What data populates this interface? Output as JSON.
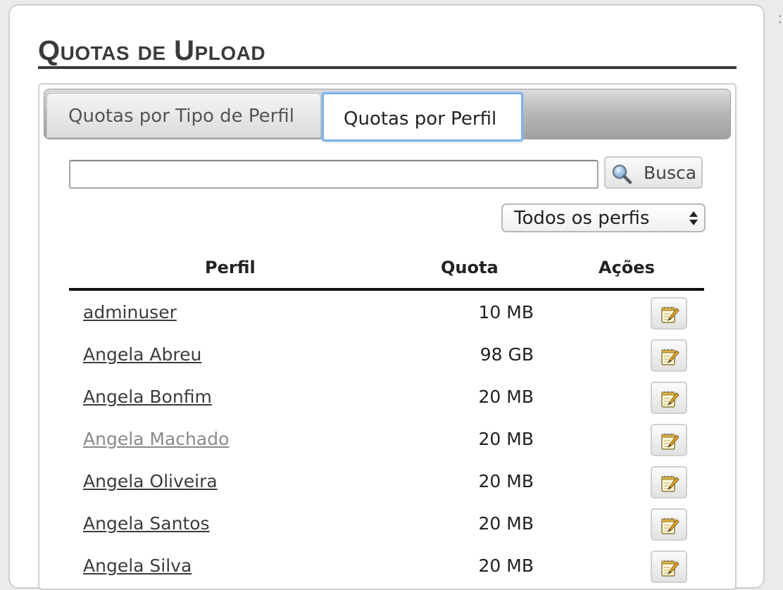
{
  "page": {
    "title": "Quotas de Upload"
  },
  "tabs": [
    {
      "label": "Quotas por Tipo de Perfil",
      "active": false
    },
    {
      "label": "Quotas por Perfil",
      "active": true
    }
  ],
  "search": {
    "value": "",
    "placeholder": "",
    "button_label": "Busca",
    "button_icon": "magnifier-icon"
  },
  "filter": {
    "selected": "Todos os perfis",
    "icon": "updown-arrows-icon"
  },
  "table": {
    "columns": [
      "Perfil",
      "Quota",
      "Ações"
    ],
    "action_icon": "notepad-edit-icon",
    "rows": [
      {
        "profile": "adminuser",
        "quota": "10 MB",
        "visited": false
      },
      {
        "profile": "Angela Abreu",
        "quota": "98 GB",
        "visited": false
      },
      {
        "profile": "Angela Bonfim",
        "quota": "20 MB",
        "visited": false
      },
      {
        "profile": "Angela Machado",
        "quota": "20 MB",
        "visited": true
      },
      {
        "profile": "Angela Oliveira",
        "quota": "20 MB",
        "visited": false
      },
      {
        "profile": "Angela Santos",
        "quota": "20 MB",
        "visited": false
      },
      {
        "profile": "Angela Silva",
        "quota": "20 MB",
        "visited": false
      }
    ]
  },
  "colors": {
    "link": "#3c3c3c",
    "link_visited": "#8a8a8a",
    "active_tab_border": "#7fb3ea",
    "title": "#3a3a3a"
  }
}
